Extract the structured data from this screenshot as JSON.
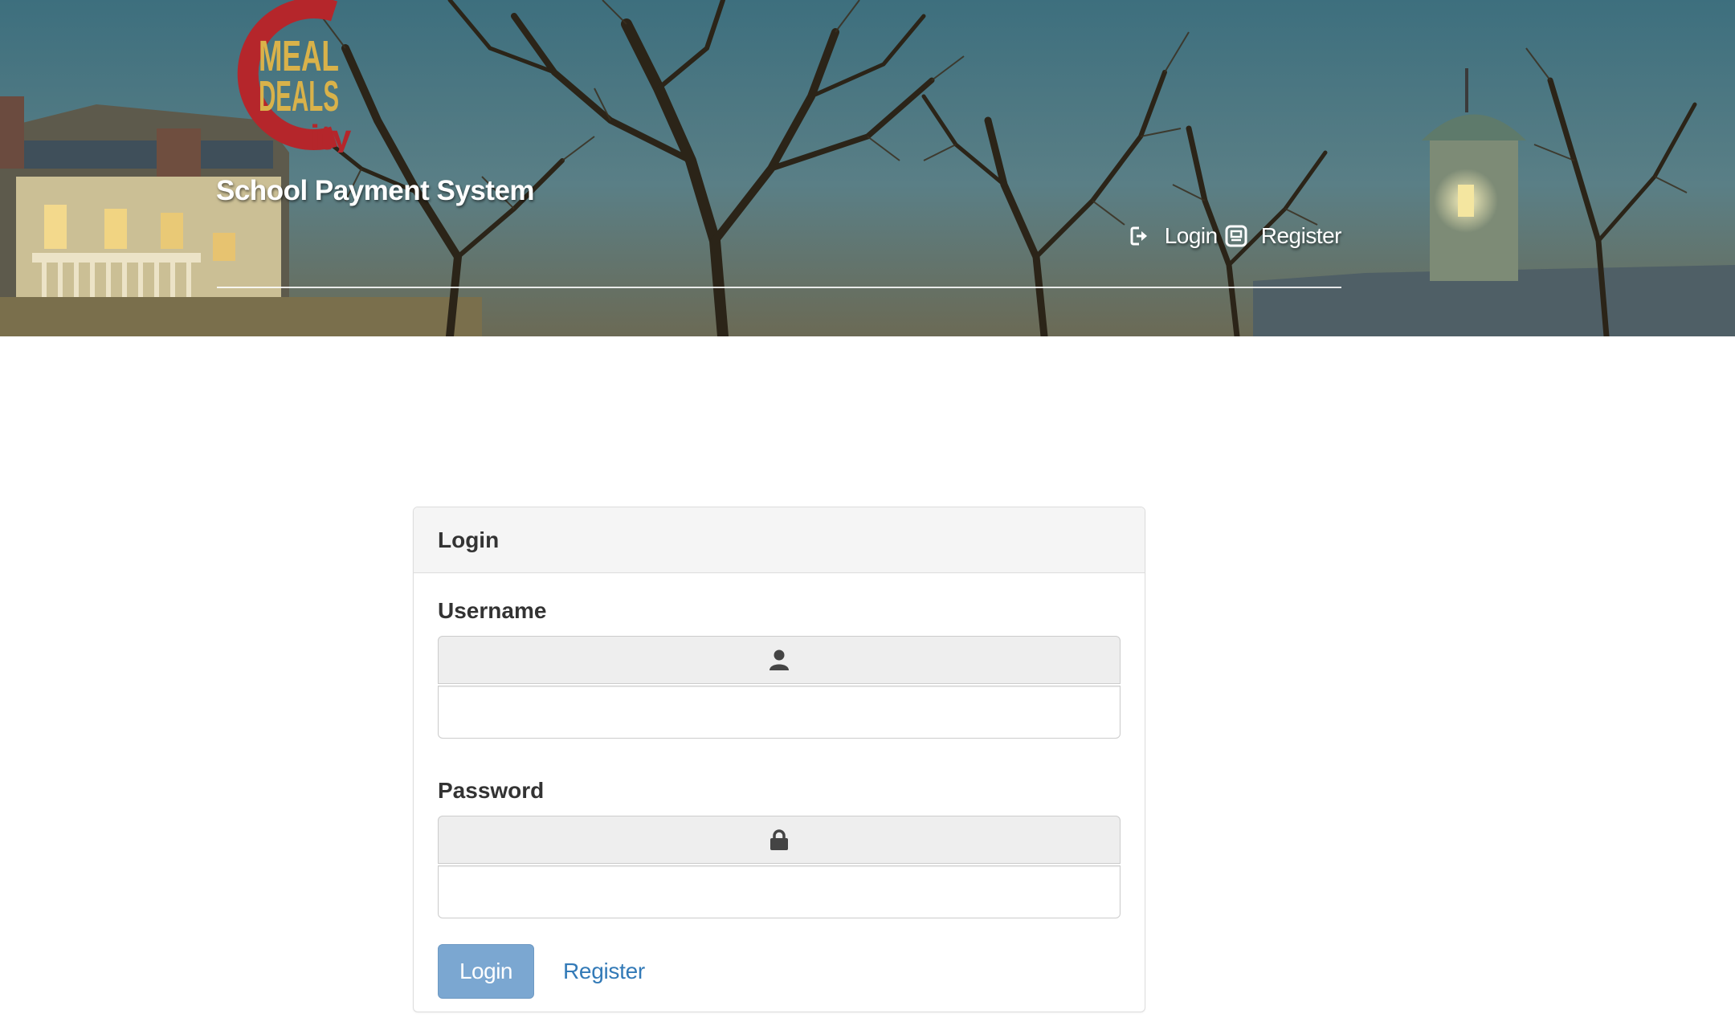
{
  "header": {
    "logo": {
      "line1": "MEAL",
      "line2": "DEALS",
      "line3": "ity"
    },
    "site_title": "School Payment System",
    "nav": {
      "login_label": "Login",
      "login_icon": "sign-in-icon",
      "register_label": "Register",
      "register_icon": "register-icon"
    }
  },
  "login_panel": {
    "heading": "Login",
    "username": {
      "label": "Username",
      "icon": "user-icon",
      "value": ""
    },
    "password": {
      "label": "Password",
      "icon": "lock-icon",
      "value": ""
    },
    "login_button": "Login",
    "register_link": "Register"
  },
  "colors": {
    "primary_button": "#7ba7d1",
    "link": "#337ab7",
    "logo_red": "#b5262b",
    "logo_gold": "#d9b24a"
  }
}
